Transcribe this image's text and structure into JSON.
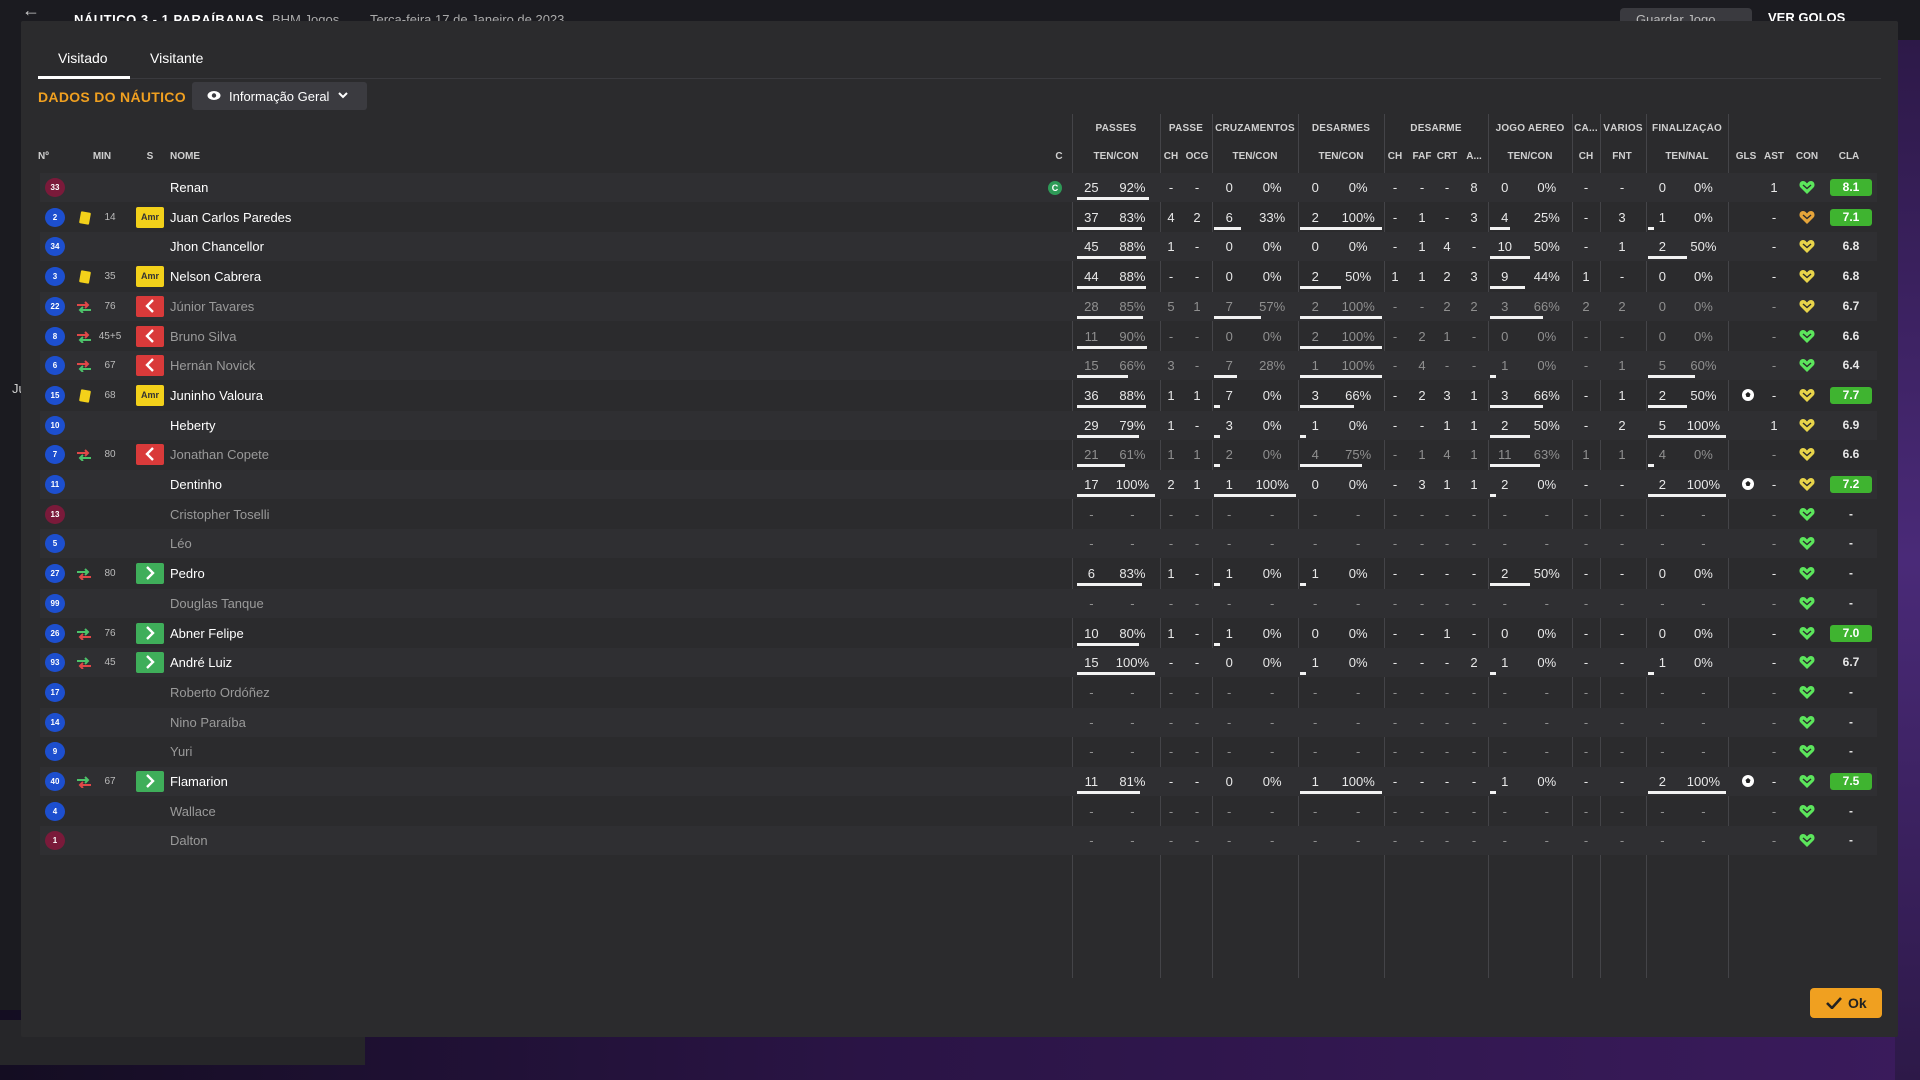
{
  "topbar": {
    "score": "NÁUTICO 3 - 1 PARAÍBANAS",
    "competition": "BHM Jogos",
    "date": "Terça-feira 17 de Janeiro de 2023",
    "save_label": "Guardar Jogo",
    "goals_label": "VER GOLOS"
  },
  "left_edge_text": "Ju",
  "tabs": [
    {
      "label": "Visitado",
      "active": true
    },
    {
      "label": "Visitante",
      "active": false
    }
  ],
  "team_title": "DADOS DO NÁUTICO",
  "view_select": {
    "label": "Informação Geral",
    "icon": "eye-icon"
  },
  "ok_label": "Ok",
  "colors": {
    "accent": "#f0a020",
    "rating_high": "#3fb430",
    "card": "#f3d11a",
    "sub_out": "#d93a3a",
    "sub_in": "#3fae5a"
  },
  "group_headers": [
    "PASSES",
    "PASSE",
    "CRUZAMENTOS",
    "DESARMES",
    "DESARME",
    "JOGO AÉREO",
    "CA...",
    "VÁRIOS",
    "FINALIZAÇÃO"
  ],
  "columns": [
    "Nº",
    "MIN",
    "S",
    "NOME",
    "C",
    "TEN/CON",
    "CH",
    "OCG",
    "TEN/CON",
    "TEN/CON",
    "CH",
    "FAF",
    "CRT",
    "A...",
    "TEN/CON",
    "CH",
    "FNT",
    "TEN/NAL",
    "GLS",
    "AST",
    "CON",
    "CLA"
  ],
  "players": [
    {
      "num": "33",
      "kit": "gk",
      "event": "",
      "min": "",
      "status": "",
      "name": "Renan",
      "captain": "C",
      "pas": [
        "25",
        "92%",
        0.92
      ],
      "ch": "-",
      "ocg": "-",
      "cru": [
        "0",
        "0%",
        0
      ],
      "des": [
        "0",
        "0%",
        0
      ],
      "dch": "-",
      "faf": "-",
      "crt": "-",
      "a": "8",
      "aer": [
        "0",
        "0%",
        0
      ],
      "ca": "-",
      "fnt": "-",
      "fin": [
        "0",
        "0%",
        0
      ],
      "gls": "",
      "ast": "1",
      "con": "green",
      "cla": "8.1",
      "hi": true,
      "dim": false,
      "motm": false
    },
    {
      "num": "2",
      "kit": "blue",
      "event": "card",
      "min": "14",
      "status": "Amr",
      "name": "Juan Carlos Paredes",
      "captain": "",
      "pas": [
        "37",
        "83%",
        0.83
      ],
      "ch": "4",
      "ocg": "2",
      "cru": [
        "6",
        "33%",
        0.33
      ],
      "des": [
        "2",
        "100%",
        1
      ],
      "dch": "-",
      "faf": "1",
      "crt": "-",
      "a": "3",
      "aer": [
        "4",
        "25%",
        0.25
      ],
      "ca": "-",
      "fnt": "3",
      "fin": [
        "1",
        "0%",
        0
      ],
      "gls": "",
      "ast": "-",
      "con": "orange",
      "cla": "7.1",
      "hi": true,
      "dim": false,
      "motm": false
    },
    {
      "num": "34",
      "kit": "blue",
      "event": "",
      "min": "",
      "status": "",
      "name": "Jhon Chancellor",
      "captain": "",
      "pas": [
        "45",
        "88%",
        0.88
      ],
      "ch": "1",
      "ocg": "-",
      "cru": [
        "0",
        "0%",
        0
      ],
      "des": [
        "0",
        "0%",
        0
      ],
      "dch": "-",
      "faf": "1",
      "crt": "4",
      "a": "-",
      "aer": [
        "10",
        "50%",
        0.5
      ],
      "ca": "-",
      "fnt": "1",
      "fin": [
        "2",
        "50%",
        0.5
      ],
      "gls": "",
      "ast": "-",
      "con": "yellow",
      "cla": "6.8",
      "hi": false,
      "dim": false,
      "motm": false
    },
    {
      "num": "3",
      "kit": "blue",
      "event": "card",
      "min": "35",
      "status": "Amr",
      "name": "Nelson Cabrera",
      "captain": "",
      "pas": [
        "44",
        "88%",
        0.88
      ],
      "ch": "-",
      "ocg": "-",
      "cru": [
        "0",
        "0%",
        0
      ],
      "des": [
        "2",
        "50%",
        0.5
      ],
      "dch": "1",
      "faf": "1",
      "crt": "2",
      "a": "3",
      "aer": [
        "9",
        "44%",
        0.44
      ],
      "ca": "1",
      "fnt": "-",
      "fin": [
        "0",
        "0%",
        0
      ],
      "gls": "",
      "ast": "-",
      "con": "yellow",
      "cla": "6.8",
      "hi": false,
      "dim": false,
      "motm": false
    },
    {
      "num": "22",
      "kit": "blue",
      "event": "sub",
      "min": "76",
      "status": "out",
      "name": "Júnior Tavares",
      "captain": "",
      "pas": [
        "28",
        "85%",
        0.85
      ],
      "ch": "5",
      "ocg": "1",
      "cru": [
        "7",
        "57%",
        0.57
      ],
      "des": [
        "2",
        "100%",
        1
      ],
      "dch": "-",
      "faf": "-",
      "crt": "2",
      "a": "2",
      "aer": [
        "3",
        "66%",
        0.66
      ],
      "ca": "2",
      "fnt": "2",
      "fin": [
        "0",
        "0%",
        0
      ],
      "gls": "",
      "ast": "-",
      "con": "yellow",
      "cla": "6.7",
      "hi": false,
      "dim": true,
      "motm": false
    },
    {
      "num": "8",
      "kit": "blue",
      "event": "sub",
      "min": "45+5",
      "status": "out",
      "name": "Bruno Silva",
      "captain": "",
      "pas": [
        "11",
        "90%",
        0.9
      ],
      "ch": "-",
      "ocg": "-",
      "cru": [
        "0",
        "0%",
        0
      ],
      "des": [
        "2",
        "100%",
        1
      ],
      "dch": "-",
      "faf": "2",
      "crt": "1",
      "a": "-",
      "aer": [
        "0",
        "0%",
        0
      ],
      "ca": "-",
      "fnt": "-",
      "fin": [
        "0",
        "0%",
        0
      ],
      "gls": "",
      "ast": "-",
      "con": "green",
      "cla": "6.6",
      "hi": false,
      "dim": true,
      "motm": false
    },
    {
      "num": "6",
      "kit": "blue",
      "event": "sub",
      "min": "67",
      "status": "out",
      "name": "Hernán Novick",
      "captain": "",
      "pas": [
        "15",
        "66%",
        0.66
      ],
      "ch": "3",
      "ocg": "-",
      "cru": [
        "7",
        "28%",
        0.28
      ],
      "des": [
        "1",
        "100%",
        1
      ],
      "dch": "-",
      "faf": "4",
      "crt": "-",
      "a": "-",
      "aer": [
        "1",
        "0%",
        0
      ],
      "ca": "-",
      "fnt": "1",
      "fin": [
        "5",
        "60%",
        0.6
      ],
      "gls": "",
      "ast": "-",
      "con": "green",
      "cla": "6.4",
      "hi": false,
      "dim": true,
      "motm": false
    },
    {
      "num": "15",
      "kit": "blue",
      "event": "card",
      "min": "68",
      "status": "Amr",
      "name": "Juninho Valoura",
      "captain": "",
      "pas": [
        "36",
        "88%",
        0.88
      ],
      "ch": "1",
      "ocg": "1",
      "cru": [
        "7",
        "0%",
        0
      ],
      "des": [
        "3",
        "66%",
        0.66
      ],
      "dch": "-",
      "faf": "2",
      "crt": "3",
      "a": "1",
      "aer": [
        "3",
        "66%",
        0.66
      ],
      "ca": "-",
      "fnt": "1",
      "fin": [
        "2",
        "50%",
        0.5
      ],
      "gls": "",
      "ast": "-",
      "con": "yellow",
      "cla": "7.7",
      "hi": true,
      "dim": false,
      "motm": true
    },
    {
      "num": "10",
      "kit": "blue",
      "event": "",
      "min": "",
      "status": "",
      "name": "Heberty",
      "captain": "",
      "pas": [
        "29",
        "79%",
        0.79
      ],
      "ch": "1",
      "ocg": "-",
      "cru": [
        "3",
        "0%",
        0
      ],
      "des": [
        "1",
        "0%",
        0
      ],
      "dch": "-",
      "faf": "-",
      "crt": "1",
      "a": "1",
      "aer": [
        "2",
        "50%",
        0.5
      ],
      "ca": "-",
      "fnt": "2",
      "fin": [
        "5",
        "100%",
        1
      ],
      "gls": "",
      "ast": "1",
      "con": "yellow",
      "cla": "6.9",
      "hi": false,
      "dim": false,
      "motm": false
    },
    {
      "num": "7",
      "kit": "blue",
      "event": "sub",
      "min": "80",
      "status": "out",
      "name": "Jonathan Copete",
      "captain": "",
      "pas": [
        "21",
        "61%",
        0.61
      ],
      "ch": "1",
      "ocg": "1",
      "cru": [
        "2",
        "0%",
        0
      ],
      "des": [
        "4",
        "75%",
        0.75
      ],
      "dch": "-",
      "faf": "1",
      "crt": "4",
      "a": "1",
      "aer": [
        "11",
        "63%",
        0.63
      ],
      "ca": "1",
      "fnt": "1",
      "fin": [
        "4",
        "0%",
        0
      ],
      "gls": "",
      "ast": "-",
      "con": "yellow",
      "cla": "6.6",
      "hi": false,
      "dim": true,
      "motm": false
    },
    {
      "num": "11",
      "kit": "blue",
      "event": "",
      "min": "",
      "status": "",
      "name": "Dentinho",
      "captain": "",
      "pas": [
        "17",
        "100%",
        1
      ],
      "ch": "2",
      "ocg": "1",
      "cru": [
        "1",
        "100%",
        1
      ],
      "des": [
        "0",
        "0%",
        0
      ],
      "dch": "-",
      "faf": "3",
      "crt": "1",
      "a": "1",
      "aer": [
        "2",
        "0%",
        0
      ],
      "ca": "-",
      "fnt": "-",
      "fin": [
        "2",
        "100%",
        1
      ],
      "gls": "",
      "ast": "-",
      "con": "yellow",
      "cla": "7.2",
      "hi": true,
      "dim": false,
      "motm": true
    },
    {
      "num": "13",
      "kit": "gk",
      "event": "",
      "min": "",
      "status": "",
      "name": "Cristopher Toselli",
      "captain": "",
      "pas": [
        "-",
        "-",
        0
      ],
      "ch": "-",
      "ocg": "-",
      "cru": [
        "-",
        "-",
        0
      ],
      "des": [
        "-",
        "-",
        0
      ],
      "dch": "-",
      "faf": "-",
      "crt": "-",
      "a": "-",
      "aer": [
        "-",
        "-",
        0
      ],
      "ca": "-",
      "fnt": "-",
      "fin": [
        "-",
        "-",
        0
      ],
      "gls": "",
      "ast": "-",
      "con": "green",
      "cla": "-",
      "hi": false,
      "dim": true,
      "motm": false
    },
    {
      "num": "5",
      "kit": "blue",
      "event": "",
      "min": "",
      "status": "",
      "name": "Léo",
      "captain": "",
      "pas": [
        "-",
        "-",
        0
      ],
      "ch": "-",
      "ocg": "-",
      "cru": [
        "-",
        "-",
        0
      ],
      "des": [
        "-",
        "-",
        0
      ],
      "dch": "-",
      "faf": "-",
      "crt": "-",
      "a": "-",
      "aer": [
        "-",
        "-",
        0
      ],
      "ca": "-",
      "fnt": "-",
      "fin": [
        "-",
        "-",
        0
      ],
      "gls": "",
      "ast": "-",
      "con": "green",
      "cla": "-",
      "hi": false,
      "dim": true,
      "motm": false
    },
    {
      "num": "27",
      "kit": "blue",
      "event": "subin",
      "min": "80",
      "status": "in",
      "name": "Pedro",
      "captain": "",
      "pas": [
        "6",
        "83%",
        0.83
      ],
      "ch": "1",
      "ocg": "-",
      "cru": [
        "1",
        "0%",
        0
      ],
      "des": [
        "1",
        "0%",
        0
      ],
      "dch": "-",
      "faf": "-",
      "crt": "-",
      "a": "-",
      "aer": [
        "2",
        "50%",
        0.5
      ],
      "ca": "-",
      "fnt": "-",
      "fin": [
        "0",
        "0%",
        0
      ],
      "gls": "",
      "ast": "-",
      "con": "green",
      "cla": "-",
      "hi": false,
      "dim": false,
      "motm": false
    },
    {
      "num": "99",
      "kit": "blue",
      "event": "",
      "min": "",
      "status": "",
      "name": "Douglas Tanque",
      "captain": "",
      "pas": [
        "-",
        "-",
        0
      ],
      "ch": "-",
      "ocg": "-",
      "cru": [
        "-",
        "-",
        0
      ],
      "des": [
        "-",
        "-",
        0
      ],
      "dch": "-",
      "faf": "-",
      "crt": "-",
      "a": "-",
      "aer": [
        "-",
        "-",
        0
      ],
      "ca": "-",
      "fnt": "-",
      "fin": [
        "-",
        "-",
        0
      ],
      "gls": "",
      "ast": "-",
      "con": "green",
      "cla": "-",
      "hi": false,
      "dim": true,
      "motm": false
    },
    {
      "num": "26",
      "kit": "blue",
      "event": "subin",
      "min": "76",
      "status": "in",
      "name": "Abner Felipe",
      "captain": "",
      "pas": [
        "10",
        "80%",
        0.8
      ],
      "ch": "1",
      "ocg": "-",
      "cru": [
        "1",
        "0%",
        0
      ],
      "des": [
        "0",
        "0%",
        0
      ],
      "dch": "-",
      "faf": "-",
      "crt": "1",
      "a": "-",
      "aer": [
        "0",
        "0%",
        0
      ],
      "ca": "-",
      "fnt": "-",
      "fin": [
        "0",
        "0%",
        0
      ],
      "gls": "",
      "ast": "-",
      "con": "green",
      "cla": "7.0",
      "hi": true,
      "dim": false,
      "motm": false
    },
    {
      "num": "93",
      "kit": "blue",
      "event": "subin",
      "min": "45",
      "status": "in",
      "name": "André Luiz",
      "captain": "",
      "pas": [
        "15",
        "100%",
        1
      ],
      "ch": "-",
      "ocg": "-",
      "cru": [
        "0",
        "0%",
        0
      ],
      "des": [
        "1",
        "0%",
        0
      ],
      "dch": "-",
      "faf": "-",
      "crt": "-",
      "a": "2",
      "aer": [
        "1",
        "0%",
        0
      ],
      "ca": "-",
      "fnt": "-",
      "fin": [
        "1",
        "0%",
        0
      ],
      "gls": "",
      "ast": "-",
      "con": "green",
      "cla": "6.7",
      "hi": false,
      "dim": false,
      "motm": false
    },
    {
      "num": "17",
      "kit": "blue",
      "event": "",
      "min": "",
      "status": "",
      "name": "Roberto Ordóñez",
      "captain": "",
      "pas": [
        "-",
        "-",
        0
      ],
      "ch": "-",
      "ocg": "-",
      "cru": [
        "-",
        "-",
        0
      ],
      "des": [
        "-",
        "-",
        0
      ],
      "dch": "-",
      "faf": "-",
      "crt": "-",
      "a": "-",
      "aer": [
        "-",
        "-",
        0
      ],
      "ca": "-",
      "fnt": "-",
      "fin": [
        "-",
        "-",
        0
      ],
      "gls": "",
      "ast": "-",
      "con": "green",
      "cla": "-",
      "hi": false,
      "dim": true,
      "motm": false
    },
    {
      "num": "14",
      "kit": "blue",
      "event": "",
      "min": "",
      "status": "",
      "name": "Nino Paraíba",
      "captain": "",
      "pas": [
        "-",
        "-",
        0
      ],
      "ch": "-",
      "ocg": "-",
      "cru": [
        "-",
        "-",
        0
      ],
      "des": [
        "-",
        "-",
        0
      ],
      "dch": "-",
      "faf": "-",
      "crt": "-",
      "a": "-",
      "aer": [
        "-",
        "-",
        0
      ],
      "ca": "-",
      "fnt": "-",
      "fin": [
        "-",
        "-",
        0
      ],
      "gls": "",
      "ast": "-",
      "con": "green",
      "cla": "-",
      "hi": false,
      "dim": true,
      "motm": false
    },
    {
      "num": "9",
      "kit": "blue",
      "event": "",
      "min": "",
      "status": "",
      "name": "Yuri",
      "captain": "",
      "pas": [
        "-",
        "-",
        0
      ],
      "ch": "-",
      "ocg": "-",
      "cru": [
        "-",
        "-",
        0
      ],
      "des": [
        "-",
        "-",
        0
      ],
      "dch": "-",
      "faf": "-",
      "crt": "-",
      "a": "-",
      "aer": [
        "-",
        "-",
        0
      ],
      "ca": "-",
      "fnt": "-",
      "fin": [
        "-",
        "-",
        0
      ],
      "gls": "",
      "ast": "-",
      "con": "green",
      "cla": "-",
      "hi": false,
      "dim": true,
      "motm": false
    },
    {
      "num": "40",
      "kit": "blue",
      "event": "subin",
      "min": "67",
      "status": "in",
      "name": "Flamarion",
      "captain": "",
      "pas": [
        "11",
        "81%",
        0.81
      ],
      "ch": "-",
      "ocg": "-",
      "cru": [
        "0",
        "0%",
        0
      ],
      "des": [
        "1",
        "100%",
        1
      ],
      "dch": "-",
      "faf": "-",
      "crt": "-",
      "a": "-",
      "aer": [
        "1",
        "0%",
        0
      ],
      "ca": "-",
      "fnt": "-",
      "fin": [
        "2",
        "100%",
        1
      ],
      "gls": "",
      "ast": "-",
      "con": "green",
      "cla": "7.5",
      "hi": true,
      "dim": false,
      "motm": true
    },
    {
      "num": "4",
      "kit": "blue",
      "event": "",
      "min": "",
      "status": "",
      "name": "Wallace",
      "captain": "",
      "pas": [
        "-",
        "-",
        0
      ],
      "ch": "-",
      "ocg": "-",
      "cru": [
        "-",
        "-",
        0
      ],
      "des": [
        "-",
        "-",
        0
      ],
      "dch": "-",
      "faf": "-",
      "crt": "-",
      "a": "-",
      "aer": [
        "-",
        "-",
        0
      ],
      "ca": "-",
      "fnt": "-",
      "fin": [
        "-",
        "-",
        0
      ],
      "gls": "",
      "ast": "-",
      "con": "green",
      "cla": "-",
      "hi": false,
      "dim": true,
      "motm": false
    },
    {
      "num": "1",
      "kit": "gk",
      "event": "",
      "min": "",
      "status": "",
      "name": "Dalton",
      "captain": "",
      "pas": [
        "-",
        "-",
        0
      ],
      "ch": "-",
      "ocg": "-",
      "cru": [
        "-",
        "-",
        0
      ],
      "des": [
        "-",
        "-",
        0
      ],
      "dch": "-",
      "faf": "-",
      "crt": "-",
      "a": "-",
      "aer": [
        "-",
        "-",
        0
      ],
      "ca": "-",
      "fnt": "-",
      "fin": [
        "-",
        "-",
        0
      ],
      "gls": "",
      "ast": "-",
      "con": "green",
      "cla": "-",
      "hi": false,
      "dim": true,
      "motm": false
    }
  ]
}
